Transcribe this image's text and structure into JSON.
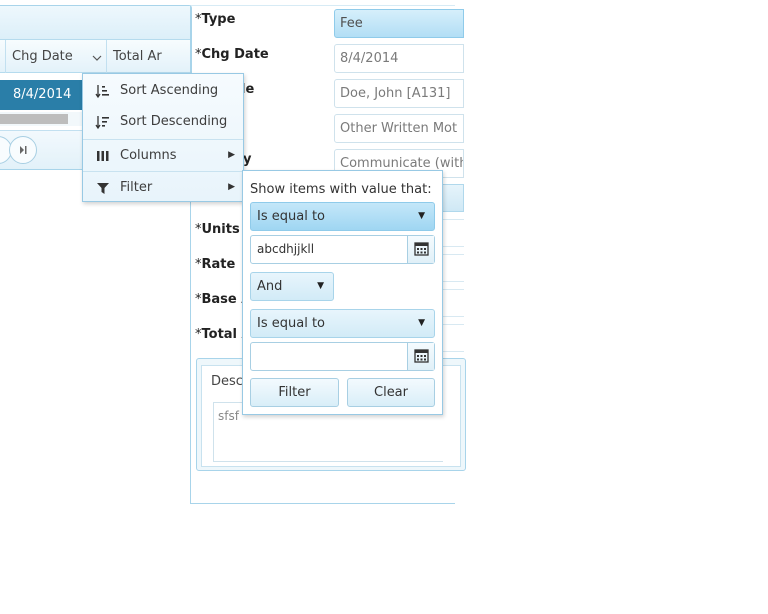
{
  "grid": {
    "columns": [
      "Chg Date",
      "Total Ar"
    ],
    "row": {
      "chg_date": "8/4/2014"
    }
  },
  "form": {
    "labels": {
      "type": "Type",
      "chg_date": "Chg Date",
      "partial_3": "le",
      "partial_5": "y",
      "units": "Units",
      "rate": "Rate",
      "base": "Base A",
      "total": "Total A"
    },
    "required_marker": "*",
    "values": {
      "type": "Fee",
      "chg_date": "8/4/2014",
      "person": "Doe, John [A131]",
      "category": "Other Written Mot",
      "activity": "Communicate (with"
    },
    "description": {
      "legend": "Desc",
      "text": "sfsf"
    }
  },
  "column_menu": {
    "items": [
      {
        "label": "Sort Ascending",
        "icon": "sort-ascending-icon"
      },
      {
        "label": "Sort Descending",
        "icon": "sort-descending-icon"
      },
      {
        "label": "Columns",
        "icon": "columns-icon",
        "submenu": true
      },
      {
        "label": "Filter",
        "icon": "filter-icon",
        "submenu": true
      }
    ]
  },
  "filter_popup": {
    "title": "Show items with value that:",
    "operator1": "Is equal to",
    "value1": "abcdhjjkll",
    "logic": "And",
    "operator2": "Is equal to",
    "value2": "",
    "filter_button": "Filter",
    "clear_button": "Clear"
  },
  "colors": {
    "selected_row": "#2a7ea8",
    "accent_border": "#98c9e4",
    "active_dropdown": "#9fd6f2"
  }
}
